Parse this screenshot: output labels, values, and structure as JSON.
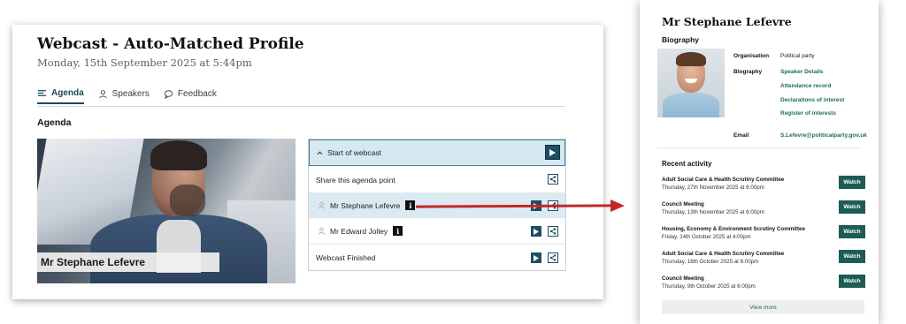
{
  "webcast": {
    "title": "Webcast - Auto-Matched Profile",
    "date": "Monday, 15th September 2025 at 5:44pm",
    "tabs": [
      {
        "label": "Agenda",
        "icon": "list-icon",
        "active": true
      },
      {
        "label": "Speakers",
        "icon": "person-icon",
        "active": false
      },
      {
        "label": "Feedback",
        "icon": "chat-icon",
        "active": false
      }
    ],
    "agenda_heading": "Agenda",
    "video_caption": "Mr Stephane Lefevre",
    "agenda_items": {
      "start": "Start of webcast",
      "share": "Share this agenda point",
      "speaker1": "Mr Stephane Lefevre",
      "speaker2": "Mr Edward Jolley",
      "finished": "Webcast Finished"
    },
    "info_glyph": "i"
  },
  "profile": {
    "name": "Mr Stephane Lefevre",
    "biography_heading": "Biography",
    "organisation_label": "Organisation",
    "organisation_value": "Political party",
    "biography_label": "Biography",
    "bio_links": [
      "Speaker Details",
      "Attendance record",
      "Declarations of interest",
      "Register of interests"
    ],
    "email_label": "Email",
    "email_value": "S.Lefevre@politicalparty.gov.uk",
    "recent_heading": "Recent activity",
    "watch_label": "Watch",
    "activities": [
      {
        "title": "Adult Social Care & Health Scrutiny Committee",
        "date": "Thursday, 27th November 2025 at 6:00pm"
      },
      {
        "title": "Council Meeting",
        "date": "Thursday, 13th November 2025 at 6:00pm"
      },
      {
        "title": "Housing, Economy & Environment Scrutiny Committee",
        "date": "Friday, 24th October 2025 at 4:00pm"
      },
      {
        "title": "Adult Social Care & Health Scrutiny Committee",
        "date": "Thursday, 16th October 2025 at 6:00pm"
      },
      {
        "title": "Council Meeting",
        "date": "Thursday, 9th October 2025 at 6:00pm"
      }
    ],
    "view_more": "View more"
  },
  "colors": {
    "accent": "#154a5d",
    "arrow": "#c42727",
    "watch": "#1d5c55",
    "link": "#1c6b62"
  }
}
